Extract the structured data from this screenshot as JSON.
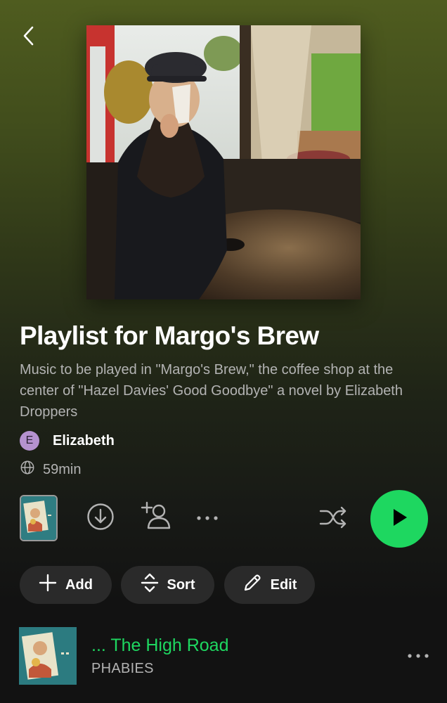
{
  "playlist": {
    "title": "Playlist for Margo's Brew",
    "description": "Music to be played in \"Margo's Brew,\" the coffee shop at the center of \"Hazel Davies' Good Goodbye\" a novel by Elizabeth Droppers",
    "owner_initial": "E",
    "owner_name": "Elizabeth",
    "duration": "59min"
  },
  "actions": {
    "add_label": "Add",
    "sort_label": "Sort",
    "edit_label": "Edit"
  },
  "tracks": [
    {
      "title": "... The High Road",
      "artist": "PHABIES",
      "playing": true
    }
  ],
  "icons": {
    "back": "chevron-left-icon",
    "public": "globe-icon",
    "download": "download-circle-icon",
    "add_collaborator": "add-person-icon",
    "more": "ellipsis-icon",
    "shuffle": "shuffle-icon",
    "play": "play-icon",
    "add": "plus-icon",
    "sort": "sort-icon",
    "edit": "pencil-icon"
  },
  "colors": {
    "accent": "#1ed760",
    "header_gradient_top": "#4f5c1f",
    "background": "#121212",
    "secondary_text": "#b3b3b3",
    "pill_background": "#2a2a2a",
    "avatar": "#b592cf"
  }
}
